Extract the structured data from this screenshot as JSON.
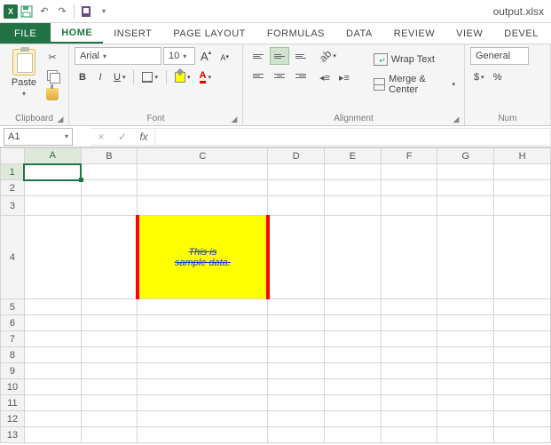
{
  "titlebar": {
    "app_char": "X",
    "filename": "output.xlsx"
  },
  "tabs": {
    "file": "FILE",
    "home": "HOME",
    "insert": "INSERT",
    "page_layout": "PAGE LAYOUT",
    "formulas": "FORMULAS",
    "data": "DATA",
    "review": "REVIEW",
    "view": "VIEW",
    "developer": "DEVEL"
  },
  "ribbon": {
    "clipboard": {
      "label": "Clipboard",
      "paste": "Paste"
    },
    "font": {
      "label": "Font",
      "name": "Arial",
      "size": "10",
      "bold": "B",
      "italic": "I",
      "underline": "U",
      "fontcolor_char": "A"
    },
    "alignment": {
      "label": "Alignment",
      "wrap": "Wrap Text",
      "merge": "Merge & Center"
    },
    "number": {
      "label": "Num",
      "format": "General",
      "currency": "$",
      "percent": "%"
    }
  },
  "fxbar": {
    "cell_ref": "A1",
    "fx_label": "fx",
    "cancel": "×",
    "confirm": "✓",
    "formula": ""
  },
  "grid": {
    "columns": [
      "A",
      "B",
      "C",
      "D",
      "E",
      "F",
      "G",
      "H"
    ],
    "col_widths": {
      "A": 68,
      "B": 68,
      "C": 154,
      "D": 68,
      "E": 68,
      "F": 68,
      "G": 68,
      "H": 68
    },
    "rows": [
      1,
      2,
      3,
      4,
      5,
      6,
      7,
      8,
      9,
      10,
      11,
      12,
      13
    ],
    "active_cell": "A1",
    "sample_cell": {
      "row": 4,
      "col": "C",
      "text_line1": "This is ",
      "text_line2": "sample data.",
      "bg": "#ffff00",
      "border_color": "#ff0000",
      "font_color": "#1a3fd0"
    }
  }
}
